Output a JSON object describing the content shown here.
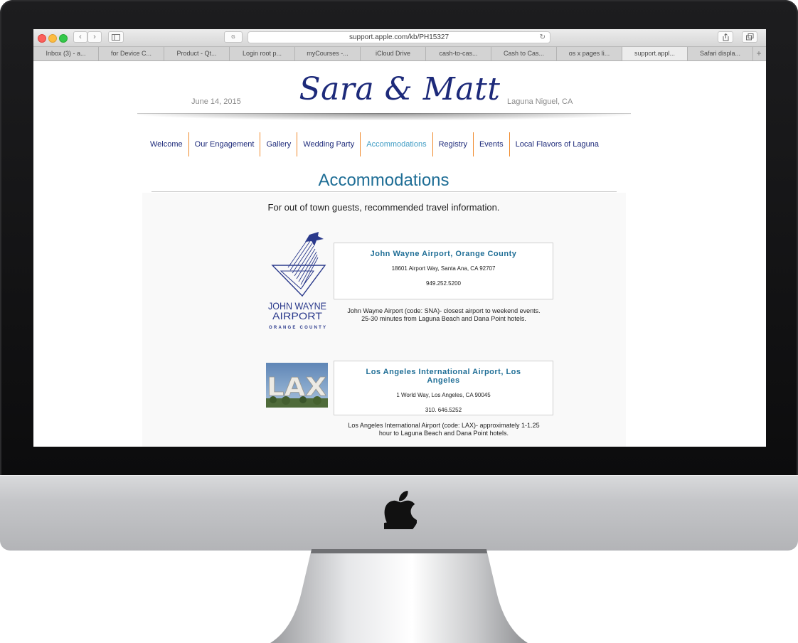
{
  "browser": {
    "url": "support.apple.com/kb/PH15327",
    "search_engine_badge": "G",
    "tabs": [
      {
        "label": "Inbox (3) - a..."
      },
      {
        "label": "for Device C..."
      },
      {
        "label": "Product - Qt..."
      },
      {
        "label": "Login root p..."
      },
      {
        "label": "myCourses -..."
      },
      {
        "label": "iCloud Drive"
      },
      {
        "label": "cash-to-cas..."
      },
      {
        "label": "Cash to Cas..."
      },
      {
        "label": "os x pages li..."
      },
      {
        "label": "support.appl..."
      },
      {
        "label": "Safari displa..."
      }
    ],
    "active_tab_index": 9,
    "new_tab": "+"
  },
  "header": {
    "date": "June 14, 2015",
    "title": "Sara & Matt",
    "location": "Laguna Niguel, CA"
  },
  "nav": {
    "items": [
      {
        "label": "Welcome"
      },
      {
        "label": "Our Engagement"
      },
      {
        "label": "Gallery"
      },
      {
        "label": "Wedding Party"
      },
      {
        "label": "Accommodations"
      },
      {
        "label": "Registry"
      },
      {
        "label": "Events"
      },
      {
        "label": "Local Flavors of Laguna"
      }
    ],
    "active_index": 4
  },
  "page": {
    "heading": "Accommodations",
    "intro": "For out of town guests, recommended travel information."
  },
  "airports": [
    {
      "name": "John Wayne Airport, Orange County",
      "address": "18601 Airport Way, Santa Ana, CA 92707",
      "phone": "949.252.5200",
      "desc_line1": "John Wayne Airport (code: SNA)- closest airport to weekend events.",
      "desc_line2": "25-30 minutes from Laguna Beach and Dana Point hotels.",
      "logo_text": [
        "JOHN WAYNE",
        "AIRPORT",
        "ORANGE COUNTY"
      ]
    },
    {
      "name_line1": "Los Angeles International Airport, Los",
      "name_line2": "Angeles",
      "address": "1 World Way, Los Angeles, CA 90045",
      "phone": "310. 646.5252",
      "desc_line1": "Los Angeles International Airport (code: LAX)- approximately 1-1.25",
      "desc_line2": "hour to Laguna Beach and Dana Point hotels.",
      "logo_text": "LAX"
    }
  ],
  "colors": {
    "title_navy": "#1d2a7a",
    "heading_blue": "#1f6e96",
    "nav_active": "#3f9cc4",
    "nav_divider": "#f08a2c"
  }
}
